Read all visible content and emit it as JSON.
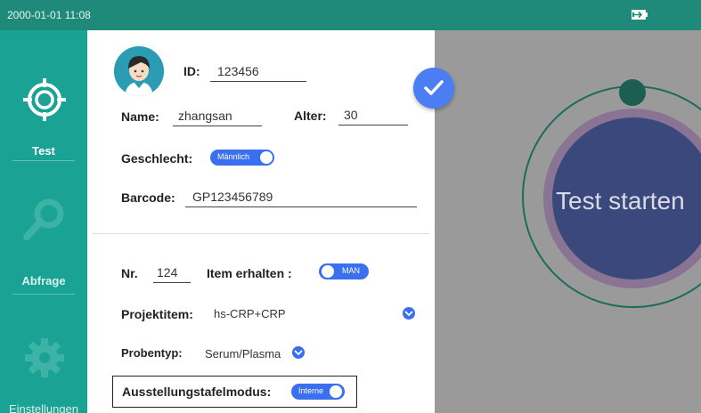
{
  "status_bar": {
    "datetime": "2000-01-01 11:08",
    "battery_icon": "charging-battery-icon"
  },
  "sidebar": {
    "items": [
      {
        "label": "Test",
        "icon": "crosshair-icon",
        "active": true
      },
      {
        "label": "Abfrage",
        "icon": "magnifier-icon",
        "active": false
      },
      {
        "label": "Einstellungen",
        "icon": "gear-icon",
        "active": false
      }
    ]
  },
  "patient": {
    "avatar_icon": "user-avatar-icon",
    "id_label": "ID:",
    "id_value": "123456",
    "name_label": "Name:",
    "name_value": "zhangsan",
    "age_label": "Alter:",
    "age_value": "30",
    "gender_label": "Geschlecht:",
    "gender_toggle_text": "Männlich",
    "barcode_label": "Barcode:",
    "barcode_value": "GP123456789"
  },
  "test_config": {
    "nr_label": "Nr.",
    "nr_value": "124",
    "item_label": "Item erhalten :",
    "item_toggle_text": "MAN",
    "project_label": "Projektitem:",
    "project_value": "hs-CRP+CRP",
    "sample_label": "Probentyp:",
    "sample_value": "Serum/Plasma",
    "mode_label": "Ausstellungstafelmodus:",
    "mode_toggle_text": "Interne"
  },
  "confirm_icon": "checkmark-icon",
  "start": {
    "label": "Test starten"
  },
  "colors": {
    "status_bar": "#1f8a7a",
    "sidebar": "#1aa395",
    "toggle": "#3a6ff0",
    "confirm": "#4a7ef2",
    "overlay": "#9a9a9a",
    "start_button": "#3a487c",
    "ring": "#8a7494"
  }
}
